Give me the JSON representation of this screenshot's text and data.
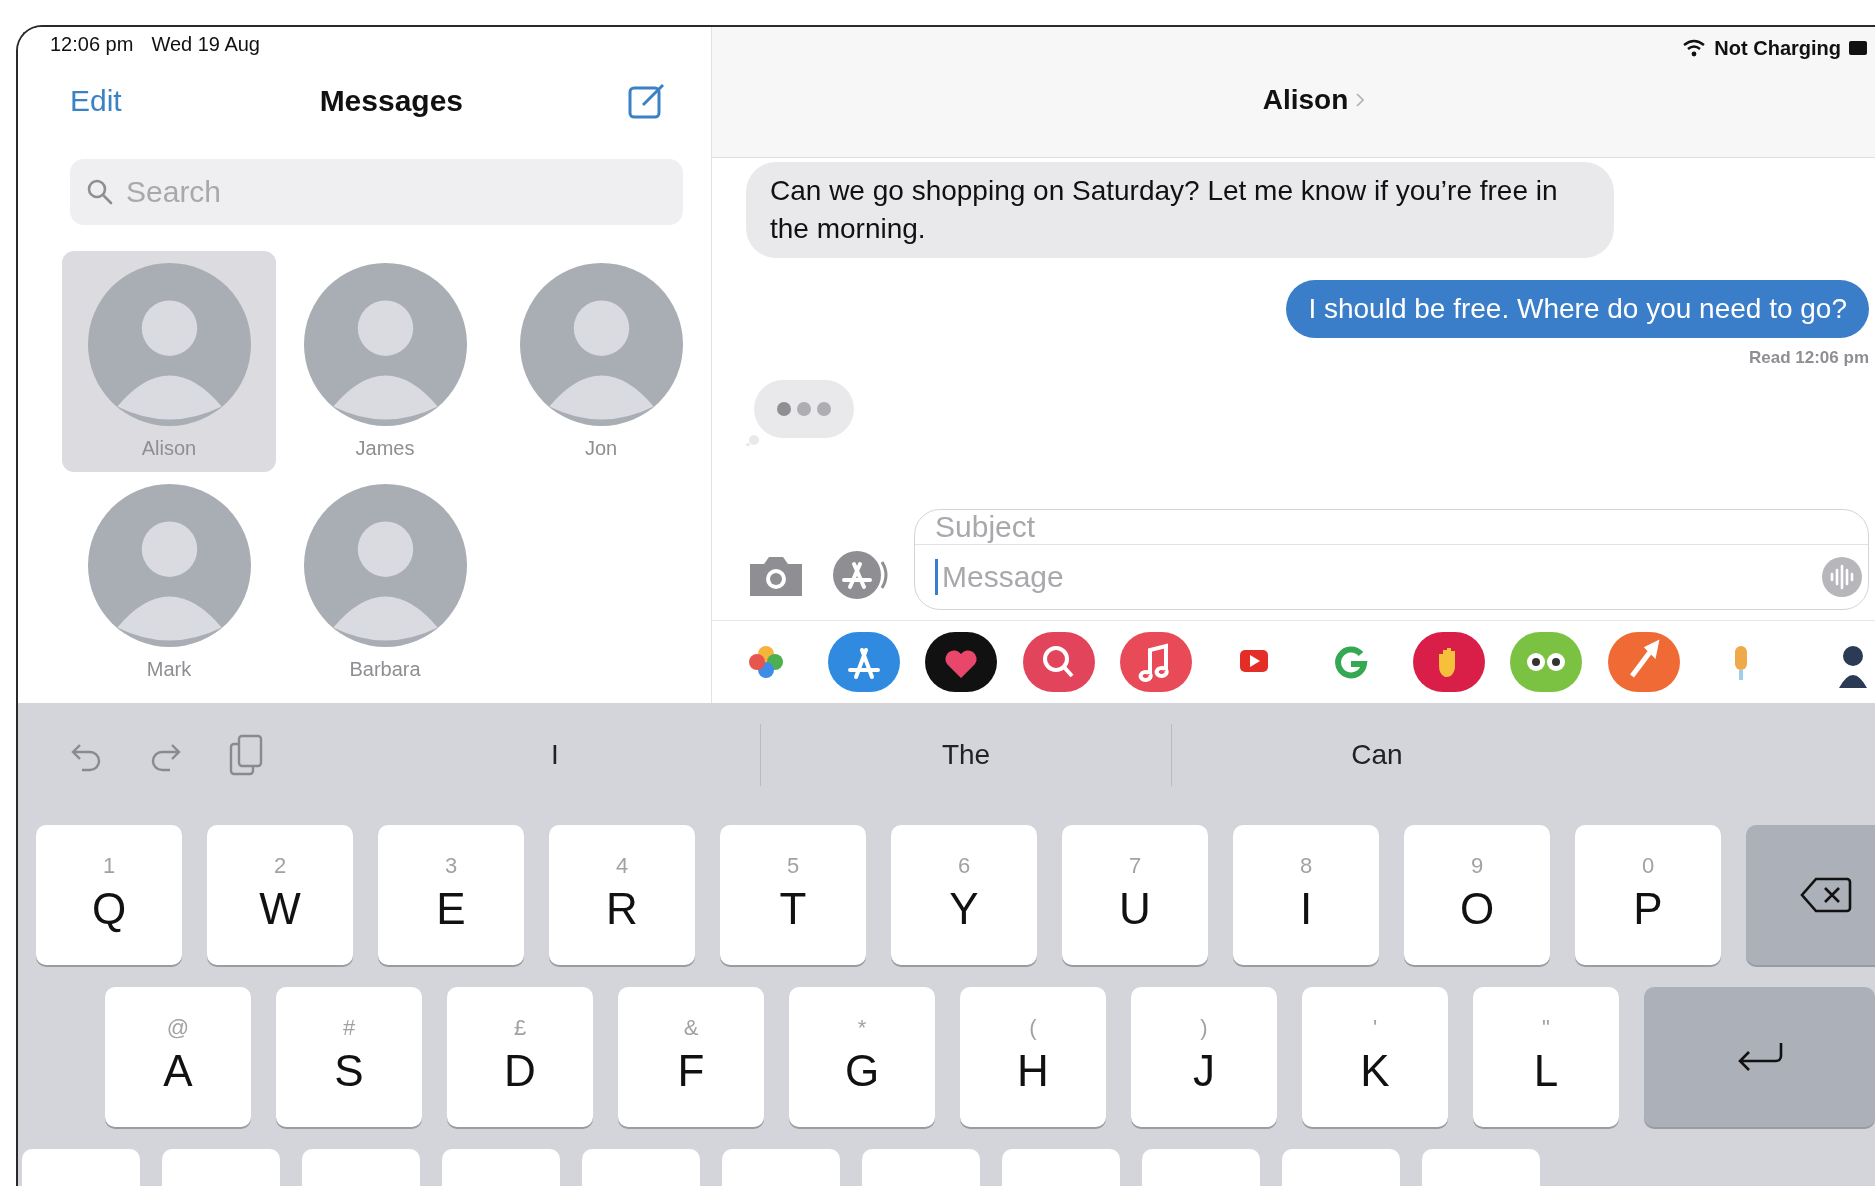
{
  "status_bar": {
    "time": "12:06 pm",
    "date": "Wed 19 Aug",
    "battery_text": "Not Charging"
  },
  "sidebar": {
    "edit": "Edit",
    "title": "Messages",
    "search": {
      "placeholder": "Search"
    },
    "pinned": [
      {
        "name": "Alison",
        "selected": true
      },
      {
        "name": "James",
        "selected": false
      },
      {
        "name": "Jon",
        "selected": false
      },
      {
        "name": "Mark",
        "selected": false
      },
      {
        "name": "Barbara",
        "selected": false
      }
    ]
  },
  "conversation": {
    "contact": "Alison",
    "messages": [
      {
        "kind": "incoming",
        "text": "Can we go shopping on Saturday? Let me know if you’re free in the morning."
      },
      {
        "kind": "outgoing",
        "text": "I should be free. Where do you need to go?",
        "receipt": "Read 12:06 pm"
      },
      {
        "kind": "typing"
      }
    ],
    "compose": {
      "subject_placeholder": "Subject",
      "message_placeholder": "Message"
    }
  },
  "keyboard": {
    "predictions": [
      "I",
      "The",
      "Can"
    ],
    "rows": [
      [
        {
          "kind": "letter",
          "main": "Q",
          "alt": "1"
        },
        {
          "kind": "letter",
          "main": "W",
          "alt": "2"
        },
        {
          "kind": "letter",
          "main": "E",
          "alt": "3"
        },
        {
          "kind": "letter",
          "main": "R",
          "alt": "4"
        },
        {
          "kind": "letter",
          "main": "T",
          "alt": "5"
        },
        {
          "kind": "letter",
          "main": "Y",
          "alt": "6"
        },
        {
          "kind": "letter",
          "main": "U",
          "alt": "7"
        },
        {
          "kind": "letter",
          "main": "I",
          "alt": "8"
        },
        {
          "kind": "letter",
          "main": "O",
          "alt": "9"
        },
        {
          "kind": "letter",
          "main": "P",
          "alt": "0"
        },
        {
          "kind": "delete"
        }
      ],
      [
        {
          "kind": "letter",
          "main": "A",
          "alt": "@"
        },
        {
          "kind": "letter",
          "main": "S",
          "alt": "#"
        },
        {
          "kind": "letter",
          "main": "D",
          "alt": "£"
        },
        {
          "kind": "letter",
          "main": "F",
          "alt": "&"
        },
        {
          "kind": "letter",
          "main": "G",
          "alt": "*"
        },
        {
          "kind": "letter",
          "main": "H",
          "alt": "("
        },
        {
          "kind": "letter",
          "main": "J",
          "alt": ")"
        },
        {
          "kind": "letter",
          "main": "K",
          "alt": "'"
        },
        {
          "kind": "letter",
          "main": "L",
          "alt": "\""
        },
        {
          "kind": "return"
        }
      ]
    ]
  }
}
